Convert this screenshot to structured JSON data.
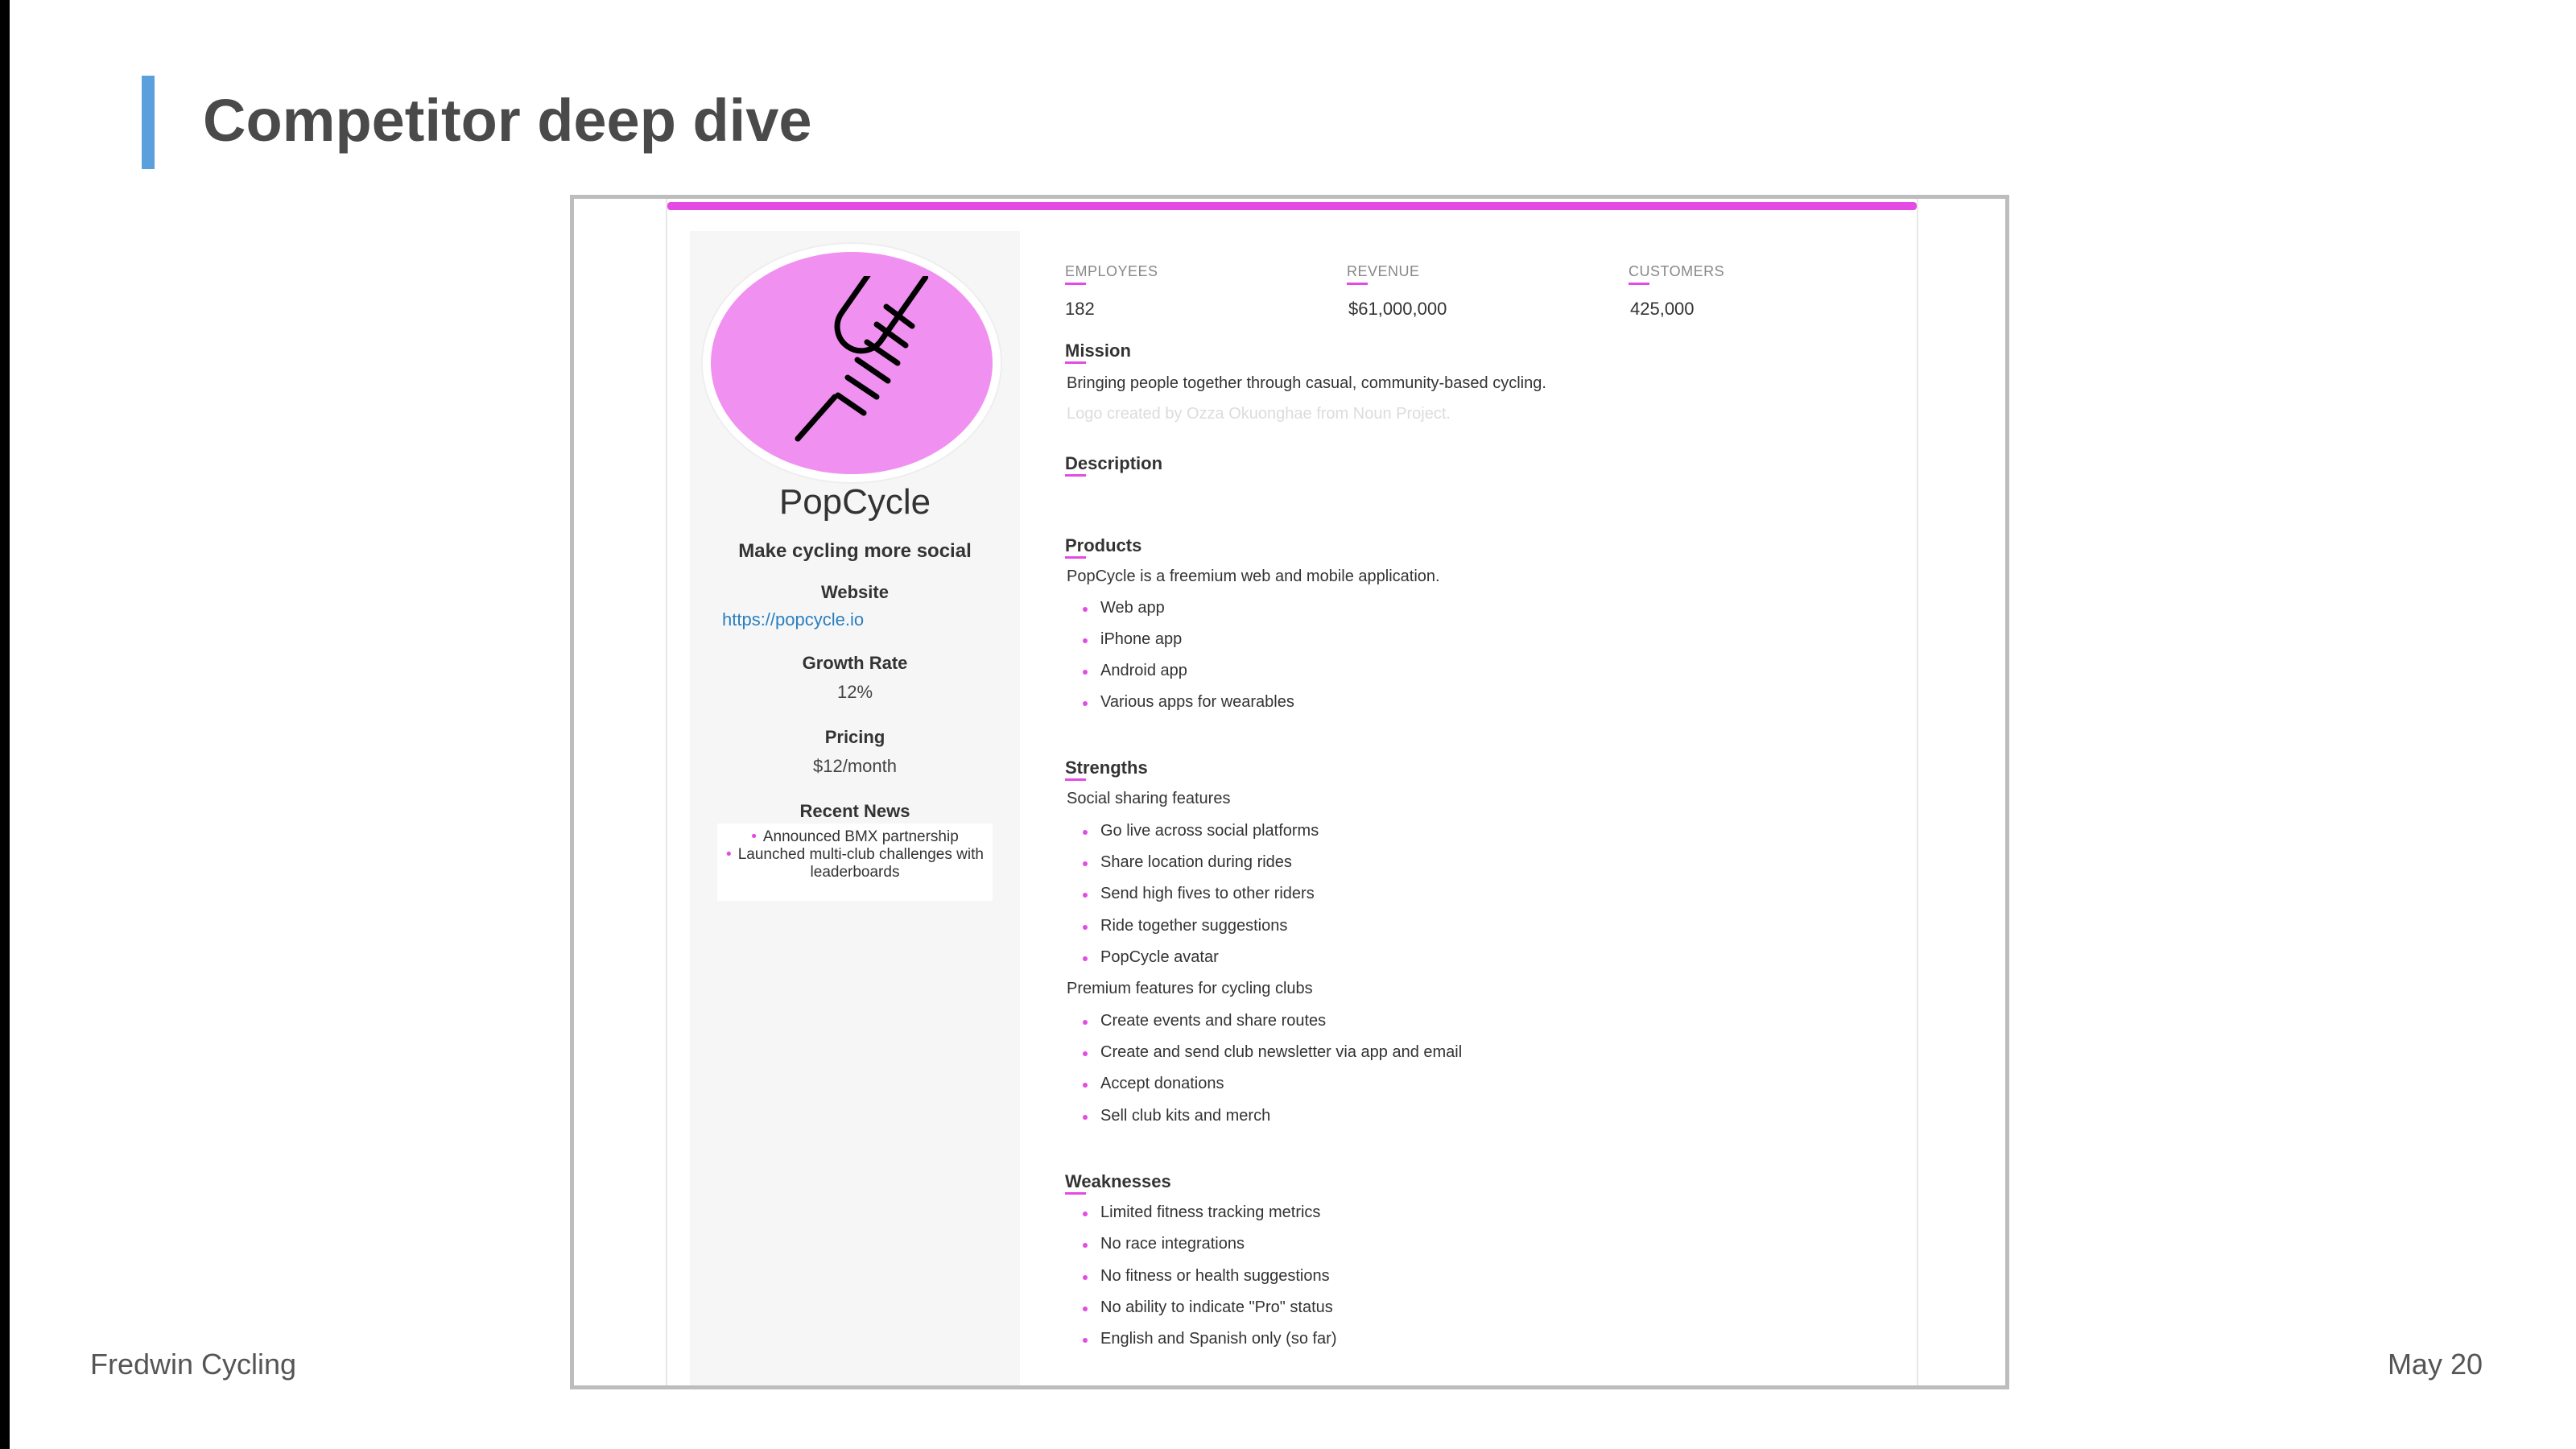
{
  "slide": {
    "title": "Competitor deep dive",
    "footer_left": "Fredwin Cycling",
    "footer_right": "May 20",
    "accent_color": "#5aa0dc"
  },
  "card": {
    "accent_color": "#e44be4",
    "logo_icon": "popsicle-icon",
    "company_name": "PopCycle",
    "tagline": "Make cycling more social",
    "website_label": "Website",
    "website_url": "https://popcycle.io",
    "growth_label": "Growth Rate",
    "growth_value": "12%",
    "pricing_label": "Pricing",
    "pricing_value": "$12/month",
    "news_label": "Recent News",
    "news": [
      "Announced BMX partnership",
      "Launched multi-club challenges with leaderboards"
    ],
    "stats": [
      {
        "label": "EMPLOYEES",
        "value": "182"
      },
      {
        "label": "REVENUE",
        "value": "$61,000,000"
      },
      {
        "label": "CUSTOMERS",
        "value": "425,000"
      }
    ],
    "mission_title": "Mission",
    "mission_text": "Bringing people together through casual, community-based cycling.",
    "logo_credit": "Logo created by Ozza Okuonghae from Noun Project.",
    "description_title": "Description",
    "products_title": "Products",
    "products_text": "PopCycle is a freemium web and mobile application.",
    "products": [
      "Web app",
      "iPhone app",
      "Android app",
      "Various apps for wearables"
    ],
    "strengths_title": "Strengths",
    "strengths_group1": "Social sharing features",
    "strengths1": [
      "Go live across social platforms",
      "Share location during rides",
      "Send high fives to other riders",
      "Ride together suggestions",
      "PopCycle avatar"
    ],
    "strengths_group2": "Premium features for cycling clubs",
    "strengths2": [
      "Create events and share routes",
      "Create and send club newsletter via app and email",
      "Accept donations",
      "Sell club kits and merch"
    ],
    "weaknesses_title": "Weaknesses",
    "weaknesses": [
      "Limited fitness tracking metrics",
      "No race integrations",
      "No fitness or health suggestions",
      "No ability to indicate \"Pro\" status",
      "English and Spanish only (so far)"
    ]
  }
}
